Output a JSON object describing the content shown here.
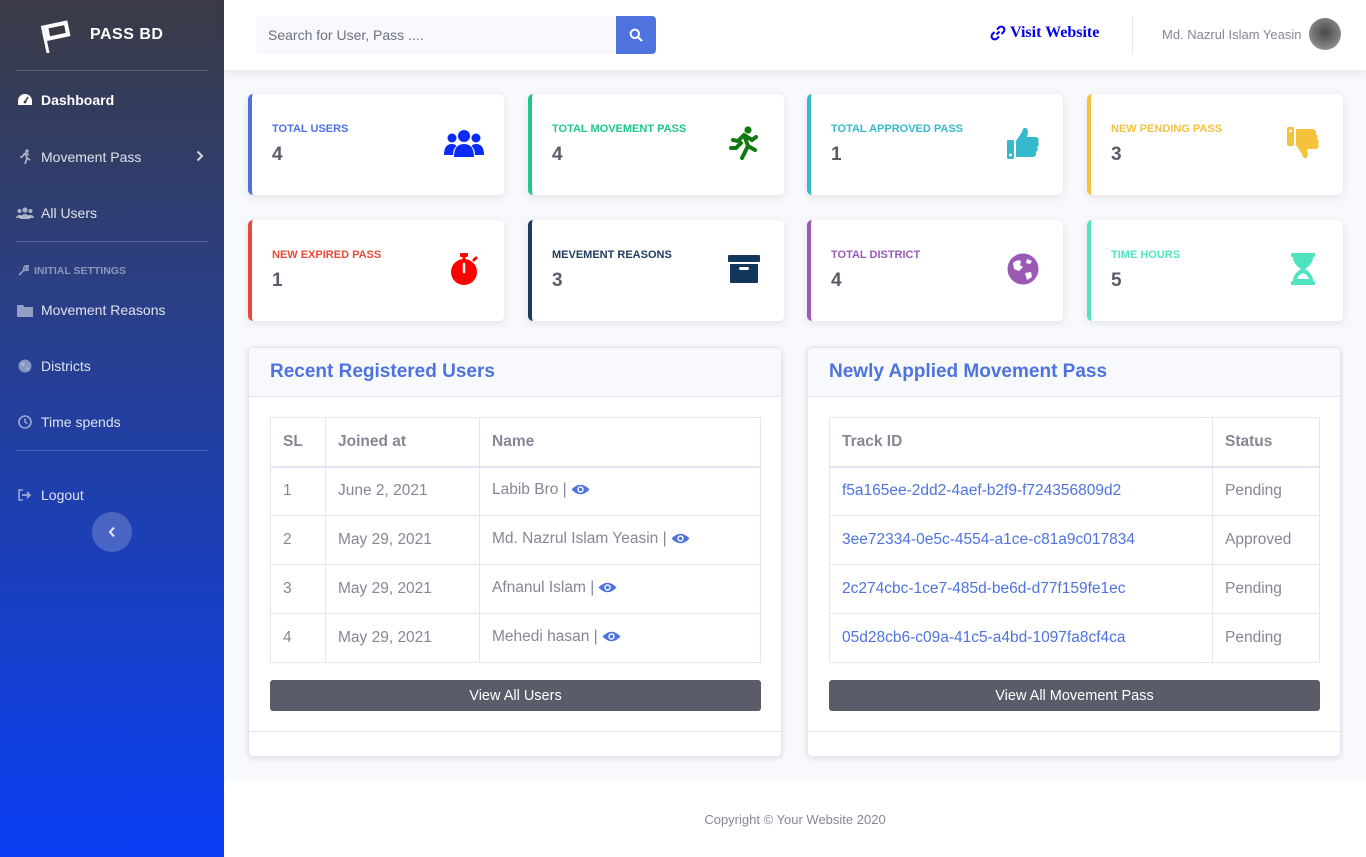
{
  "brand": {
    "name": "PASS BD"
  },
  "sidebar": {
    "items": [
      {
        "label": "Dashboard",
        "icon": "tachometer-icon"
      },
      {
        "label": "Movement Pass",
        "icon": "running-icon"
      },
      {
        "label": "All Users",
        "icon": "users-icon"
      }
    ],
    "heading": "Initial Settings",
    "settings_items": [
      {
        "label": "Movement Reasons",
        "icon": "folder-icon"
      },
      {
        "label": "Districts",
        "icon": "globe-icon"
      },
      {
        "label": "Time spends",
        "icon": "clock-icon"
      }
    ],
    "logout": "Logout"
  },
  "topbar": {
    "search_placeholder": "Search for User, Pass ....",
    "visit_label": "Visit Website",
    "user_name": "Md. Nazrul Islam Yeasin"
  },
  "stats": [
    {
      "label": "Total Users",
      "value": "4",
      "color": "#4e73df",
      "icon_color": "#0a2bf5"
    },
    {
      "label": "Total Movement Pass",
      "value": "4",
      "color": "#1cc88a",
      "icon_color": "#0f7a0f"
    },
    {
      "label": "Total Approved Pass",
      "value": "1",
      "color": "#36b9cc",
      "icon_color": "#36b9cc"
    },
    {
      "label": "New Pending Pass",
      "value": "3",
      "color": "#f6c23e",
      "icon_color": "#f6c23e"
    },
    {
      "label": "New Expired Pass",
      "value": "1",
      "color": "#e74a3b",
      "icon_color": "#ff0000"
    },
    {
      "label": "Mevement Reasons",
      "value": "3",
      "color": "#1e3a5f",
      "icon_color": "#13365c"
    },
    {
      "label": "Total District",
      "value": "4",
      "color": "#9b59b6",
      "icon_color": "#9b59b6"
    },
    {
      "label": "Time Hours",
      "value": "5",
      "color": "#4fe3c1",
      "icon_color": "#4fe3c1"
    }
  ],
  "users_panel": {
    "title": "Recent Registered Users",
    "headers": [
      "SL",
      "Joined at",
      "Name"
    ],
    "rows": [
      {
        "sl": "1",
        "joined": "June 2, 2021",
        "name": "Labib Bro |"
      },
      {
        "sl": "2",
        "joined": "May 29, 2021",
        "name": "Md. Nazrul Islam Yeasin |"
      },
      {
        "sl": "3",
        "joined": "May 29, 2021",
        "name": "Afnanul Islam |"
      },
      {
        "sl": "4",
        "joined": "May 29, 2021",
        "name": "Mehedi hasan |"
      }
    ],
    "button": "View All Users"
  },
  "pass_panel": {
    "title": "Newly Applied Movement Pass",
    "headers": [
      "Track ID",
      "Status"
    ],
    "rows": [
      {
        "track": "f5a165ee-2dd2-4aef-b2f9-f724356809d2",
        "status": "Pending"
      },
      {
        "track": "3ee72334-0e5c-4554-a1ce-c81a9c017834",
        "status": "Approved"
      },
      {
        "track": "2c274cbc-1ce7-485d-be6d-d77f159fe1ec",
        "status": "Pending"
      },
      {
        "track": "05d28cb6-c09a-41c5-a4bd-1097fa8cf4ca",
        "status": "Pending"
      }
    ],
    "button": "View All Movement Pass"
  },
  "footer": {
    "text": "Copyright © Your Website 2020"
  }
}
